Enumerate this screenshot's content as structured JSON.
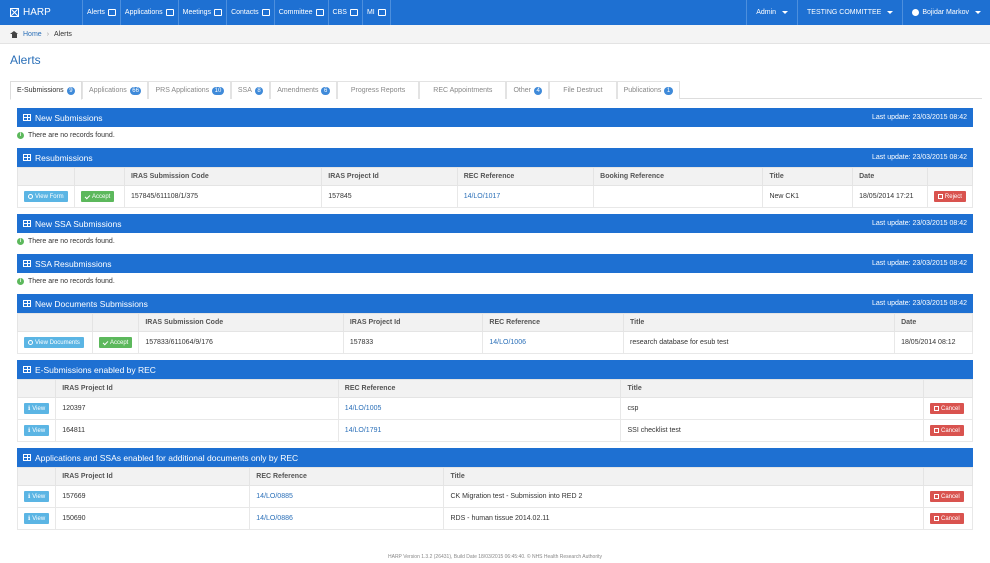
{
  "navbar": {
    "brand": "HARP",
    "items": [
      {
        "label": "Alerts",
        "icon": "monitor-icon"
      },
      {
        "label": "Applications",
        "icon": "edit-icon"
      },
      {
        "label": "Meetings",
        "icon": "calendar-icon"
      },
      {
        "label": "Contacts",
        "icon": "book-icon"
      },
      {
        "label": "Committee",
        "icon": "group-icon"
      },
      {
        "label": "CBS",
        "icon": "checkbox-icon"
      },
      {
        "label": "MI",
        "icon": "chart-icon"
      }
    ],
    "admin": "Admin",
    "committee": "TESTING COMMITTEE",
    "user": "Bojidar Markov"
  },
  "breadcrumb": {
    "home": "Home",
    "sep": "›",
    "current": "Alerts"
  },
  "page_title": "Alerts",
  "tabs": [
    {
      "label": "E-Submissions",
      "badge": "9"
    },
    {
      "label": "Applications",
      "badge": "66"
    },
    {
      "label": "PRS Applications",
      "badge": "10"
    },
    {
      "label": "SSA",
      "badge": "8"
    },
    {
      "label": "Amendments",
      "badge": "6"
    },
    {
      "label": "Progress Reports",
      "badge": ""
    },
    {
      "label": "REC Appointments",
      "badge": ""
    },
    {
      "label": "Other",
      "badge": "4"
    },
    {
      "label": "File Destruct",
      "badge": ""
    },
    {
      "label": "Publications",
      "badge": "1"
    }
  ],
  "last_update": "Last update: 23/03/2015 08:42",
  "no_records": "There are no records found.",
  "panels": {
    "new_submissions": {
      "title": "New Submissions"
    },
    "resubmissions": {
      "title": "Resubmissions",
      "headers": [
        "IRAS Submission Code",
        "IRAS Project Id",
        "REC Reference",
        "Booking Reference",
        "Title",
        "Date"
      ],
      "row": {
        "view": "View Form",
        "accept": "Accept",
        "code": "157845/611108/1/375",
        "project": "157845",
        "rec": "14/LO/1017",
        "booking": "",
        "title": "New CK1",
        "date": "18/05/2014 17:21",
        "reject": "Reject"
      }
    },
    "new_ssa": {
      "title": "New SSA Submissions"
    },
    "ssa_resub": {
      "title": "SSA Resubmissions"
    },
    "new_docs": {
      "title": "New Documents Submissions",
      "headers": [
        "IRAS Submission Code",
        "IRAS Project Id",
        "REC Reference",
        "Title",
        "Date"
      ],
      "row": {
        "view": "View Documents",
        "accept": "Accept",
        "code": "157833/611064/9/176",
        "project": "157833",
        "rec": "14/LO/1006",
        "title": "research database for esub test",
        "date": "18/05/2014 08:12"
      }
    },
    "enabled_by_rec": {
      "title": "E-Submissions enabled by REC",
      "headers": [
        "IRAS Project Id",
        "REC Reference",
        "Title"
      ],
      "rows": [
        {
          "view": "View",
          "project": "120397",
          "rec": "14/LO/1005",
          "title": "csp",
          "cancel": "Cancel"
        },
        {
          "view": "View",
          "project": "164811",
          "rec": "14/LO/1791",
          "title": "SSI checklist test",
          "cancel": "Cancel"
        }
      ]
    },
    "additional_docs": {
      "title": "Applications and SSAs enabled for additional documents only by REC",
      "headers": [
        "IRAS Project Id",
        "REC Reference",
        "Title"
      ],
      "rows": [
        {
          "view": "View",
          "project": "157669",
          "rec": "14/LO/0885",
          "title": "CK Migration test - Submission into RED 2",
          "cancel": "Cancel"
        },
        {
          "view": "View",
          "project": "150690",
          "rec": "14/LO/0886",
          "title": "RDS - human tissue 2014.02.11",
          "cancel": "Cancel"
        }
      ]
    }
  },
  "footer": "HARP Version 1.3.2 (26431), Build Date 18/03/2015 06:45:40. © NHS Health Research Authority"
}
